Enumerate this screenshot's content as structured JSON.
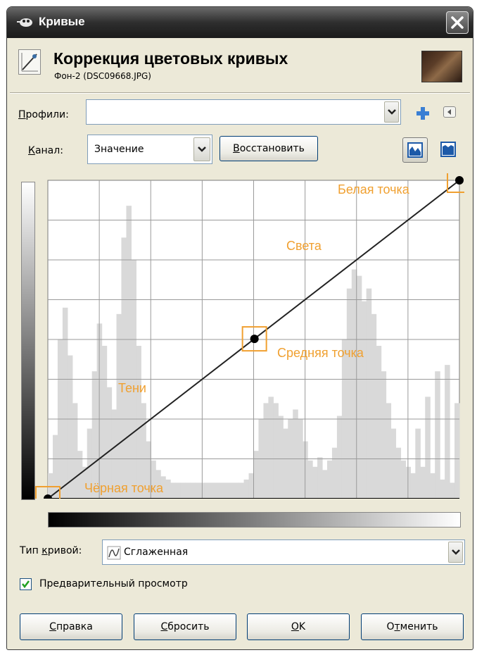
{
  "window": {
    "title": "Кривые",
    "close_symbol": "✕"
  },
  "header": {
    "heading": "Коррекция цветовых кривых",
    "subtitle": "Фон-2 (DSC09668.JPG)"
  },
  "profiles": {
    "label_accel": "П",
    "label_rest": "рофили:",
    "value": ""
  },
  "channel": {
    "label_accel": "К",
    "label_rest": "анал:",
    "value": "Значение",
    "reset_accel": "В",
    "reset_rest": "осстановить"
  },
  "graph": {
    "annotations": {
      "white_point": "Белая точка",
      "highlights": "Света",
      "mid_point": "Средняя точка",
      "shadows": "Тени",
      "black_point": "Чёрная точка"
    },
    "points": [
      {
        "input": 0,
        "output": 0
      },
      {
        "input": 128,
        "output": 128
      },
      {
        "input": 255,
        "output": 255
      }
    ],
    "histogram": [
      8,
      20,
      50,
      60,
      45,
      30,
      15,
      10,
      22,
      40,
      55,
      48,
      35,
      28,
      58,
      82,
      92,
      75,
      48,
      30,
      18,
      12,
      9,
      7,
      6,
      5,
      5,
      5,
      5,
      5,
      5,
      5,
      5,
      5,
      5,
      5,
      5,
      5,
      5,
      5,
      6,
      8,
      15,
      25,
      30,
      32,
      30,
      26,
      22,
      25,
      28,
      25,
      18,
      12,
      10,
      13,
      9,
      12,
      16,
      26,
      50,
      66,
      72,
      70,
      62,
      66,
      58,
      48,
      40,
      30,
      22,
      16,
      12,
      10,
      8,
      22,
      10,
      32,
      8,
      40,
      6,
      42,
      5,
      30
    ],
    "accent_color": "#f0a030",
    "histogram_color": "#d9d9d9"
  },
  "curve_type": {
    "label_pre": "Тип ",
    "label_accel": "к",
    "label_rest": "ривой:",
    "value": "Сглаженная"
  },
  "preview": {
    "checked": true,
    "label_pre": "Пре",
    "label_accel": "д",
    "label_rest": "варительный просмотр"
  },
  "buttons": {
    "help": {
      "accel": "С",
      "rest": "правка"
    },
    "reset": {
      "accel": "С",
      "rest": "бросить"
    },
    "ok": {
      "accel": "O",
      "rest": "K"
    },
    "cancel": {
      "pre": "О",
      "accel": "т",
      "rest": "менить"
    }
  }
}
